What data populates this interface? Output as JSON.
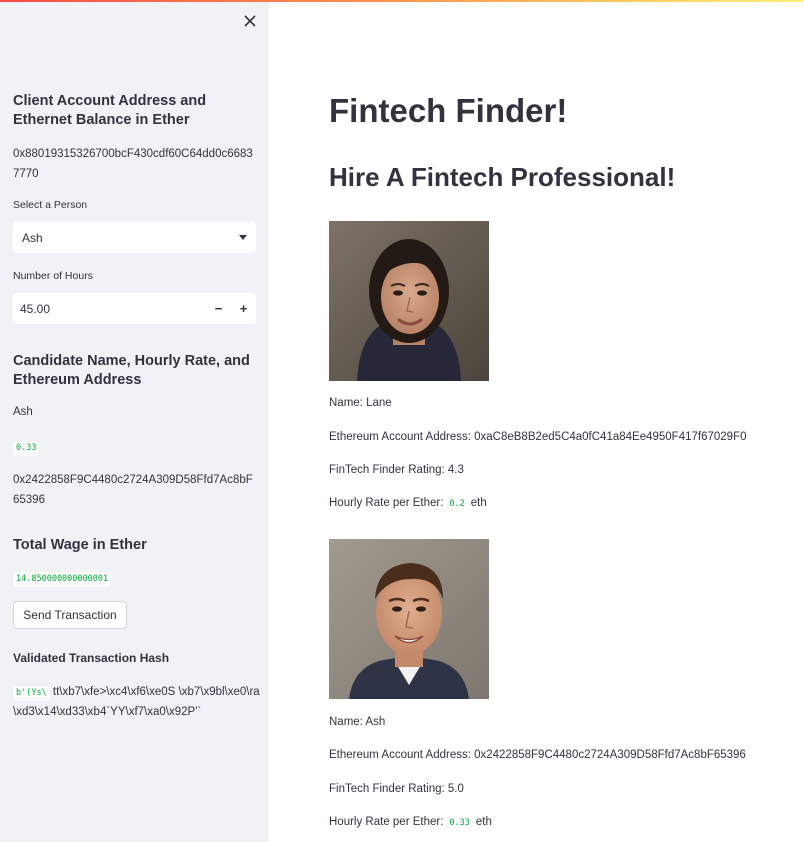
{
  "sidebar": {
    "account_heading": "Client Account Address and Ethernet Balance in Ether",
    "account_address": "0x88019315326700bcF430cdf60C64dd0c66837770",
    "select_label": "Select a Person",
    "select_value": "Ash",
    "hours_label": "Number of Hours",
    "hours_value": "45.00",
    "minus_label": "−",
    "plus_label": "+",
    "candidate_heading": "Candidate Name, Hourly Rate, and Ethereum Address",
    "candidate_name": "Ash",
    "candidate_rate": "0.33",
    "candidate_address": "0x2422858F9C4480c2724A309D58Ffd7Ac8bF65396",
    "wage_heading": "Total Wage in Ether",
    "wage_value": "14.850000000000001",
    "send_button": "Send Transaction",
    "tx_heading": "Validated Transaction Hash",
    "tx_hash_prefix": "b'(Ys\\",
    "tx_hash_rest": " tt\\xb7\\xfe>\\xc4\\xf6\\xe0S \\xb7\\x9bl\\xe0\\ra\\xd3\\x14\\xd33\\xb4`YY\\xf7\\xa0\\x92P'`"
  },
  "main": {
    "title": "Fintech Finder!",
    "subtitle": "Hire A Fintech Professional!",
    "candidates": [
      {
        "name": "Name: Lane",
        "address": "Ethereum Account Address: 0xaC8eB8B2ed5C4a0fC41a84Ee4950F417f67029F0",
        "rating": "FinTech Finder Rating: 4.3",
        "rate_label": "Hourly Rate per Ether:",
        "rate_value": "0.2",
        "rate_unit": "eth"
      },
      {
        "name": "Name: Ash",
        "address": "Ethereum Account Address: 0x2422858F9C4480c2724A309D58Ffd7Ac8bF65396",
        "rating": "FinTech Finder Rating: 5.0",
        "rate_label": "Hourly Rate per Ether:",
        "rate_value": "0.33",
        "rate_unit": "eth"
      }
    ]
  },
  "colors": {
    "sidebar_bg": "#f0f2f6",
    "code_green": "#09ab3b",
    "text": "#31333f"
  }
}
